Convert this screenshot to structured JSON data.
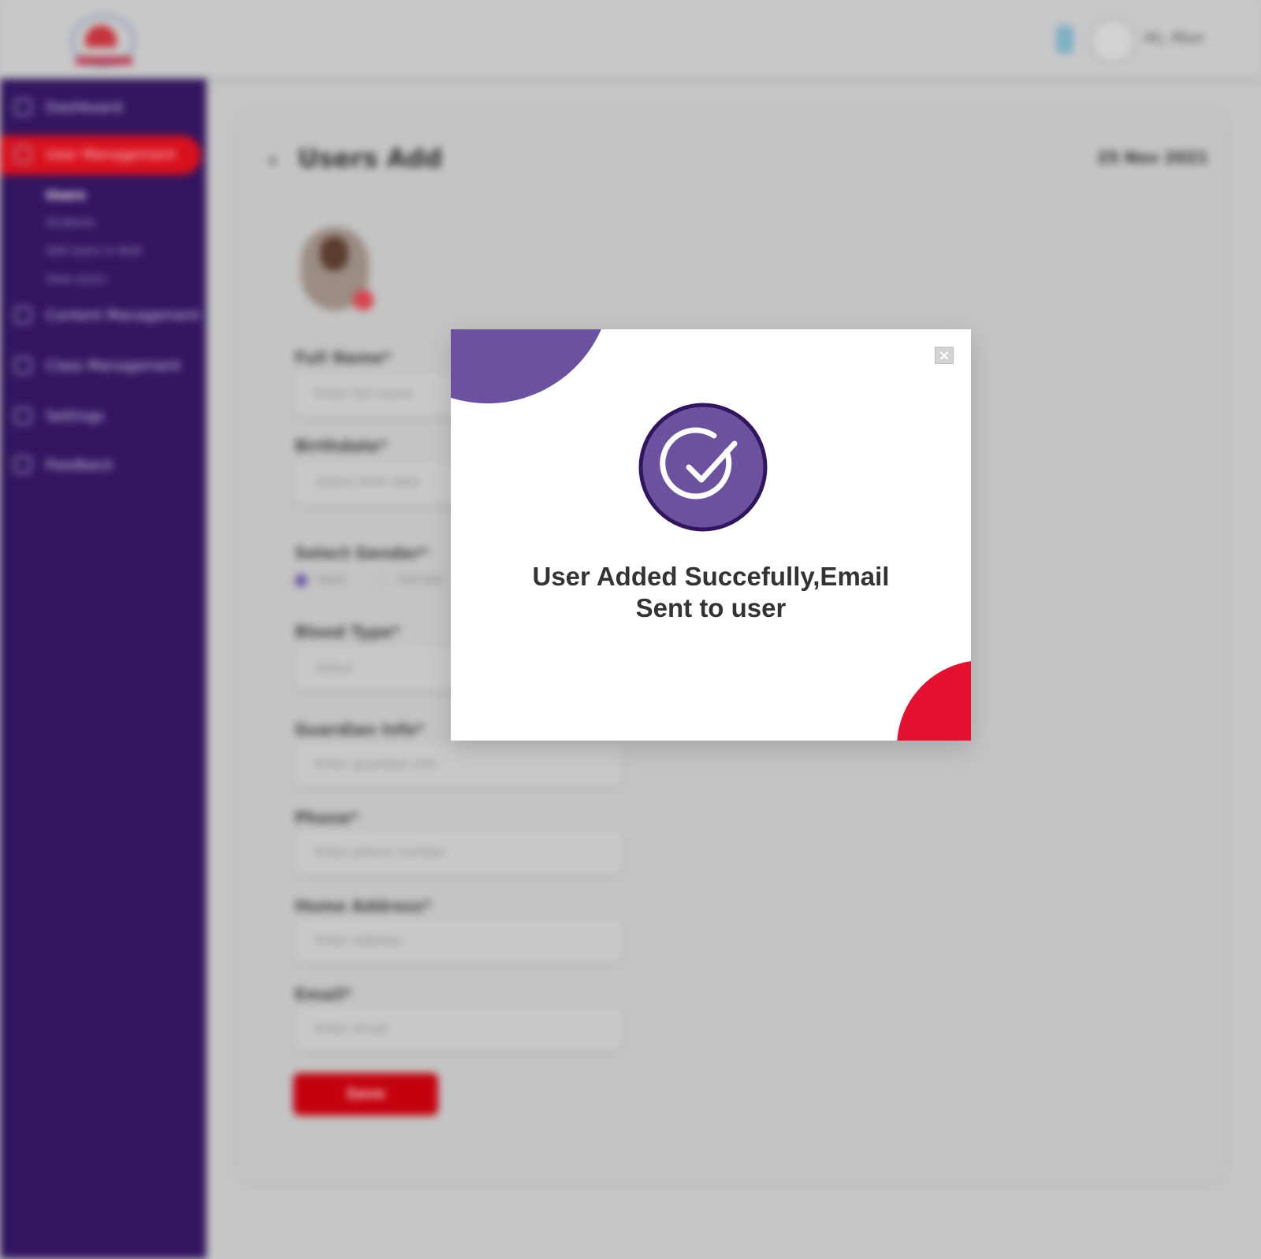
{
  "header": {
    "logo_icon": "brand-logo-icon",
    "notification_icon": "bell-icon",
    "user_name": "Hi, Max"
  },
  "sidebar": {
    "items": [
      {
        "label": "Dashboard",
        "icon": "dashboard-icon"
      },
      {
        "label": "User Management",
        "icon": "users-icon",
        "active": true
      },
      {
        "label": "Content Management",
        "icon": "content-icon"
      },
      {
        "label": "Class Management",
        "icon": "class-icon"
      },
      {
        "label": "Settings",
        "icon": "gear-icon"
      },
      {
        "label": "Feedback",
        "icon": "feedback-icon"
      }
    ],
    "sub_items": [
      {
        "label": "Users",
        "current": true
      },
      {
        "label": "Students"
      },
      {
        "label": "Add Users In Bulk"
      },
      {
        "label": "View Users"
      }
    ]
  },
  "main": {
    "back_icon": "chevron-left-icon",
    "title": "Users Add",
    "date": "25 Nov 2021",
    "form": {
      "fields": [
        {
          "label": "Full Name*",
          "placeholder": "Enter full name"
        },
        {
          "label": "Birthdate*",
          "placeholder": "Select birth date"
        }
      ],
      "gender": {
        "label": "Select Gender*",
        "options": [
          "Male",
          "Female"
        ],
        "selected": "Male"
      },
      "blood_group": {
        "label": "Blood Type*",
        "value": "Select"
      },
      "lower_fields": [
        {
          "label": "Guardian Info*",
          "placeholder": "Enter guardian info"
        },
        {
          "label": "Phone*",
          "placeholder": "Enter phone number"
        },
        {
          "label": "Home Address*",
          "placeholder": "Enter address"
        },
        {
          "label": "Email*",
          "placeholder": "Enter email"
        }
      ],
      "save_label": "Save"
    }
  },
  "modal": {
    "close_label": "×",
    "icon": "check-circle-icon",
    "message_line1": "User Added Succefully,Email",
    "message_line2": "Sent to user",
    "colors": {
      "accent_purple": "#6b519e",
      "accent_red": "#e4102f",
      "icon_outline": "#32155f"
    }
  }
}
